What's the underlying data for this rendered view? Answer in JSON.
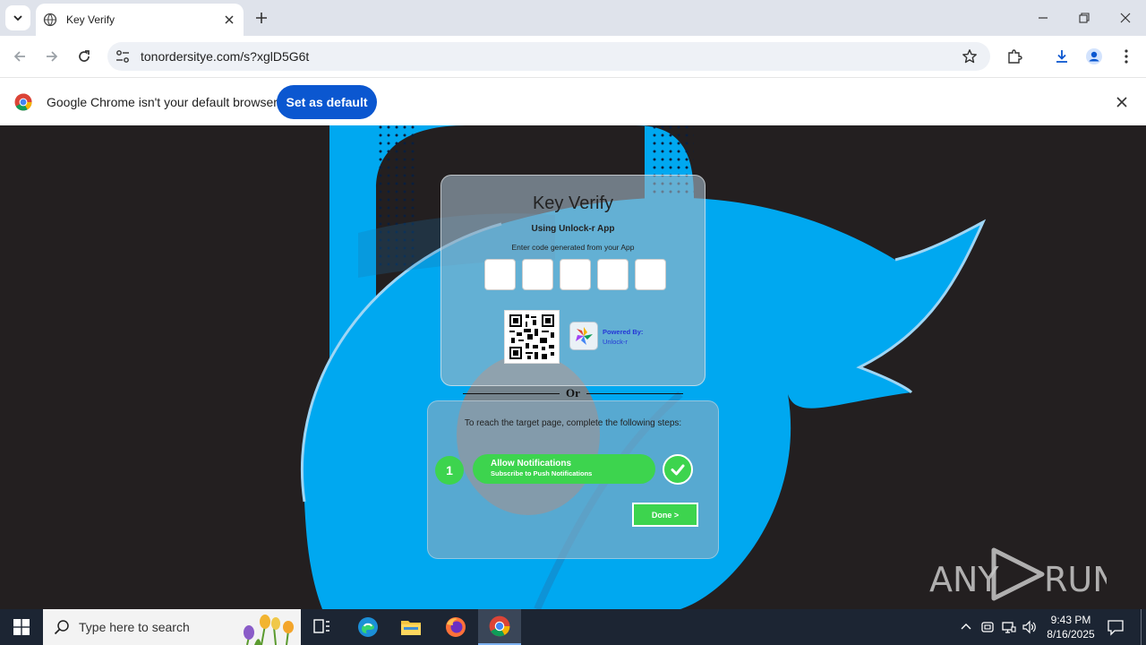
{
  "browser": {
    "tab_title": "Key Verify",
    "url": "tonordersitye.com/s?xglD5G6t",
    "infobar_message": "Google Chrome isn't your default browser",
    "infobar_button": "Set as default"
  },
  "page": {
    "title": "Key Verify",
    "subtitle": "Using Unlock-r App",
    "instruction": "Enter code generated from your App",
    "code_boxes": 5,
    "powered_by_label": "Powered By:",
    "powered_by_name": "Unlock-r",
    "or_label": "Or",
    "steps_intro": "To reach the target page, complete the following steps:",
    "step_number": "1",
    "step_title": "Allow Notifications",
    "step_subtitle": "Subscribe to Push Notifications",
    "done_button": "Done >",
    "accent_green": "#3dd44e",
    "logo_blue": "#00a8f0"
  },
  "watermark": "ANY RUN",
  "taskbar": {
    "search_placeholder": "Type here to search",
    "time": "9:43 PM",
    "date": "8/16/2025"
  },
  "icons": [
    "chevron-down-icon",
    "globe-icon",
    "close-icon",
    "plus-icon",
    "minimize-icon",
    "restore-icon",
    "back-arrow-icon",
    "forward-arrow-icon",
    "reload-icon",
    "site-info-icon",
    "star-icon",
    "extensions-icon",
    "download-icon",
    "profile-icon",
    "menu-dots-icon",
    "chrome-logo-icon",
    "qr-code-icon",
    "unlock-r-logo-icon",
    "checkmark-icon",
    "windows-start-icon",
    "search-icon",
    "task-view-icon",
    "edge-icon",
    "file-explorer-icon",
    "firefox-icon",
    "chrome-icon",
    "chevron-up-icon",
    "network-icon",
    "volume-icon",
    "notification-icon"
  ]
}
